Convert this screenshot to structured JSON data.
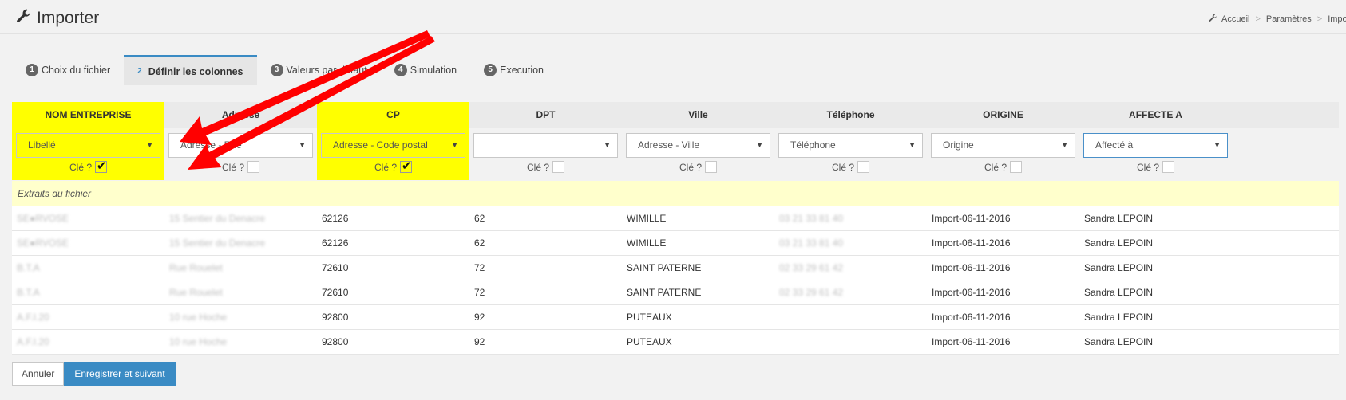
{
  "header": {
    "title": "Importer",
    "breadcrumb": [
      "Accueil",
      "Paramètres",
      "Importer"
    ]
  },
  "steps": [
    {
      "num": "1",
      "label": "Choix du fichier"
    },
    {
      "num": "2",
      "label": "Définir les colonnes"
    },
    {
      "num": "3",
      "label": "Valeurs par défaut"
    },
    {
      "num": "4",
      "label": "Simulation"
    },
    {
      "num": "5",
      "label": "Execution"
    }
  ],
  "columns": [
    {
      "header": "NOM ENTREPRISE",
      "mapping": "Libellé",
      "key_label": "Clé ?",
      "key_checked": true
    },
    {
      "header": "Adresse",
      "mapping": "Adresse - Rue",
      "key_label": "Clé ?",
      "key_checked": false
    },
    {
      "header": "CP",
      "mapping": "Adresse - Code postal",
      "key_label": "Clé ?",
      "key_checked": true
    },
    {
      "header": "DPT",
      "mapping": "",
      "key_label": "Clé ?",
      "key_checked": false
    },
    {
      "header": "Ville",
      "mapping": "Adresse - Ville",
      "key_label": "Clé ?",
      "key_checked": false
    },
    {
      "header": "Téléphone",
      "mapping": "Téléphone",
      "key_label": "Clé ?",
      "key_checked": false
    },
    {
      "header": "ORIGINE",
      "mapping": "Origine",
      "key_label": "Clé ?",
      "key_checked": false
    },
    {
      "header": "AFFECTE A",
      "mapping": "Affecté à",
      "key_label": "Clé ?",
      "key_checked": false
    }
  ],
  "extract_label": "Extraits du fichier",
  "rows": [
    [
      "SE●RVOSE",
      "15 Sentier du Denacre",
      "62126",
      "62",
      "WIMILLE",
      "03 21 33 81 40",
      "Import-06-11-2016",
      "Sandra LEPOIN"
    ],
    [
      "SE●RVOSE",
      "15 Sentier du Denacre",
      "62126",
      "62",
      "WIMILLE",
      "03 21 33 81 40",
      "Import-06-11-2016",
      "Sandra LEPOIN"
    ],
    [
      "B.T.A",
      "Rue Rouelet",
      "72610",
      "72",
      "SAINT PATERNE",
      "02 33 29 61 42",
      "Import-06-11-2016",
      "Sandra LEPOIN"
    ],
    [
      "B.T.A",
      "Rue Rouelet",
      "72610",
      "72",
      "SAINT PATERNE",
      "02 33 29 61 42",
      "Import-06-11-2016",
      "Sandra LEPOIN"
    ],
    [
      "A.F.I.20",
      "10 rue Hoche",
      "92800",
      "92",
      "PUTEAUX",
      "",
      "Import-06-11-2016",
      "Sandra LEPOIN"
    ],
    [
      "A.F.I.20",
      "10 rue Hoche",
      "92800",
      "92",
      "PUTEAUX",
      "",
      "Import-06-11-2016",
      "Sandra LEPOIN"
    ]
  ],
  "buttons": {
    "cancel": "Annuler",
    "save": "Enregistrer et suivant"
  },
  "colors": {
    "highlight": "#ffff00",
    "accent": "#3a8bc4",
    "annotation_arrow": "#ff0000"
  },
  "icons": {
    "title": "wrench-icon",
    "breadcrumb": "wrench-icon",
    "select": "caret-down-icon",
    "checkbox": "checkmark-icon"
  }
}
